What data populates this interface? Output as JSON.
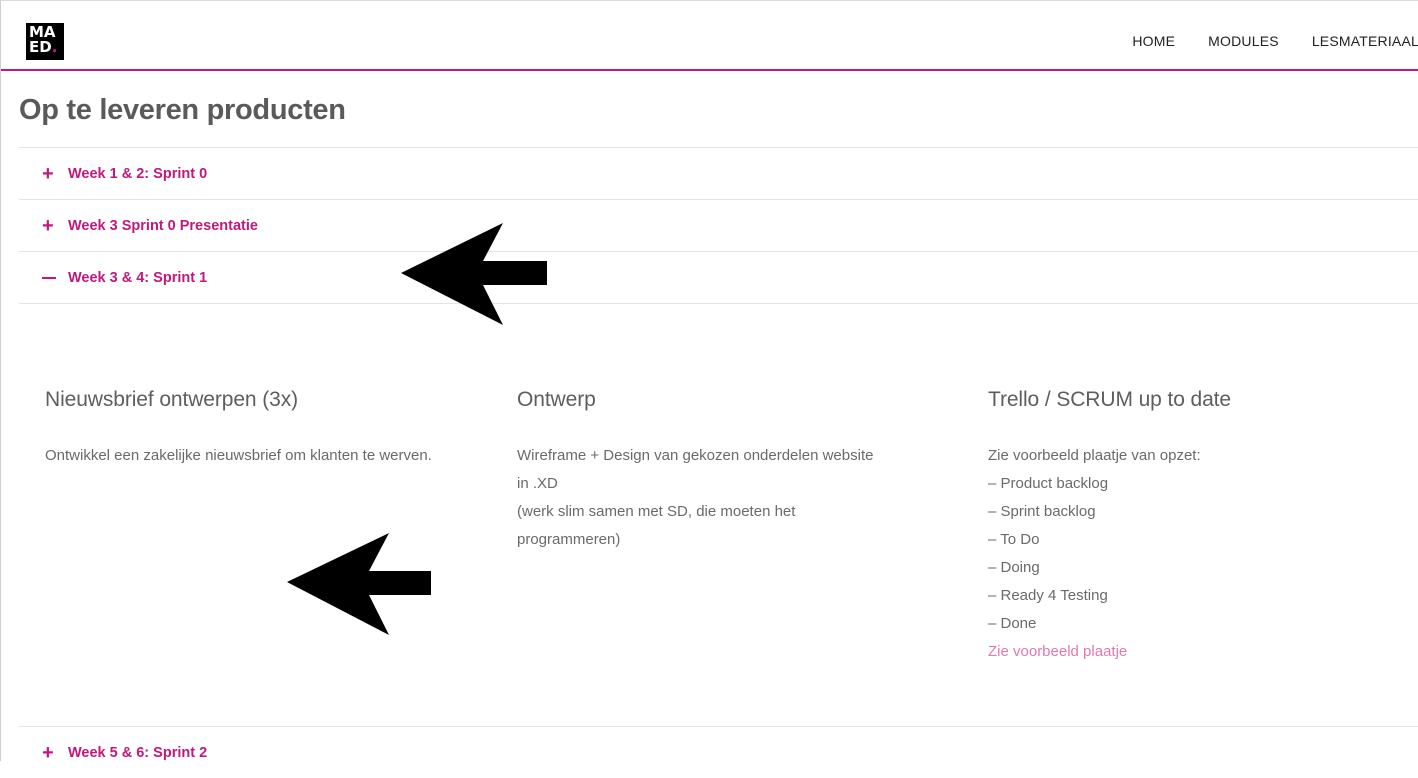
{
  "logo": {
    "line1": "MA",
    "line2": "ED",
    "dot": "."
  },
  "nav": {
    "items": [
      "HOME",
      "MODULES",
      "LESMATERIAAL"
    ]
  },
  "page_title": "Op te leveren producten",
  "accordion": [
    {
      "label": "Week 1 & 2: Sprint 0",
      "state": "collapsed"
    },
    {
      "label": "Week 3 Sprint 0 Presentatie",
      "state": "collapsed"
    },
    {
      "label": "Week 3 & 4: Sprint 1",
      "state": "expanded"
    },
    {
      "label": "Week 5 & 6: Sprint 2",
      "state": "collapsed"
    }
  ],
  "sprint1": {
    "col1": {
      "title": "Nieuwsbrief ontwerpen (3x)",
      "text": "Ontwikkel een zakelijke nieuwsbrief om klanten te werven."
    },
    "col2": {
      "title": "Ontwerp",
      "lines": [
        "Wireframe + Design van gekozen onderdelen website in .XD",
        "(werk slim samen met SD, die moeten het programmeren)"
      ]
    },
    "col3": {
      "title": "Trello / SCRUM up to date",
      "intro": "Zie voorbeeld plaatje van opzet:",
      "items": [
        "– Product backlog",
        "– Sprint backlog",
        "– To Do",
        "– Doing",
        "– Ready 4 Testing",
        "– Done"
      ],
      "link": "Zie voorbeeld plaatje"
    }
  },
  "colors": {
    "accent": "#c2187c",
    "link": "#e07ab2",
    "heading": "#5a5a5a",
    "text": "#6a6a6a"
  },
  "icons": [
    "plus-icon",
    "minus-icon",
    "left-arrow-icon"
  ]
}
